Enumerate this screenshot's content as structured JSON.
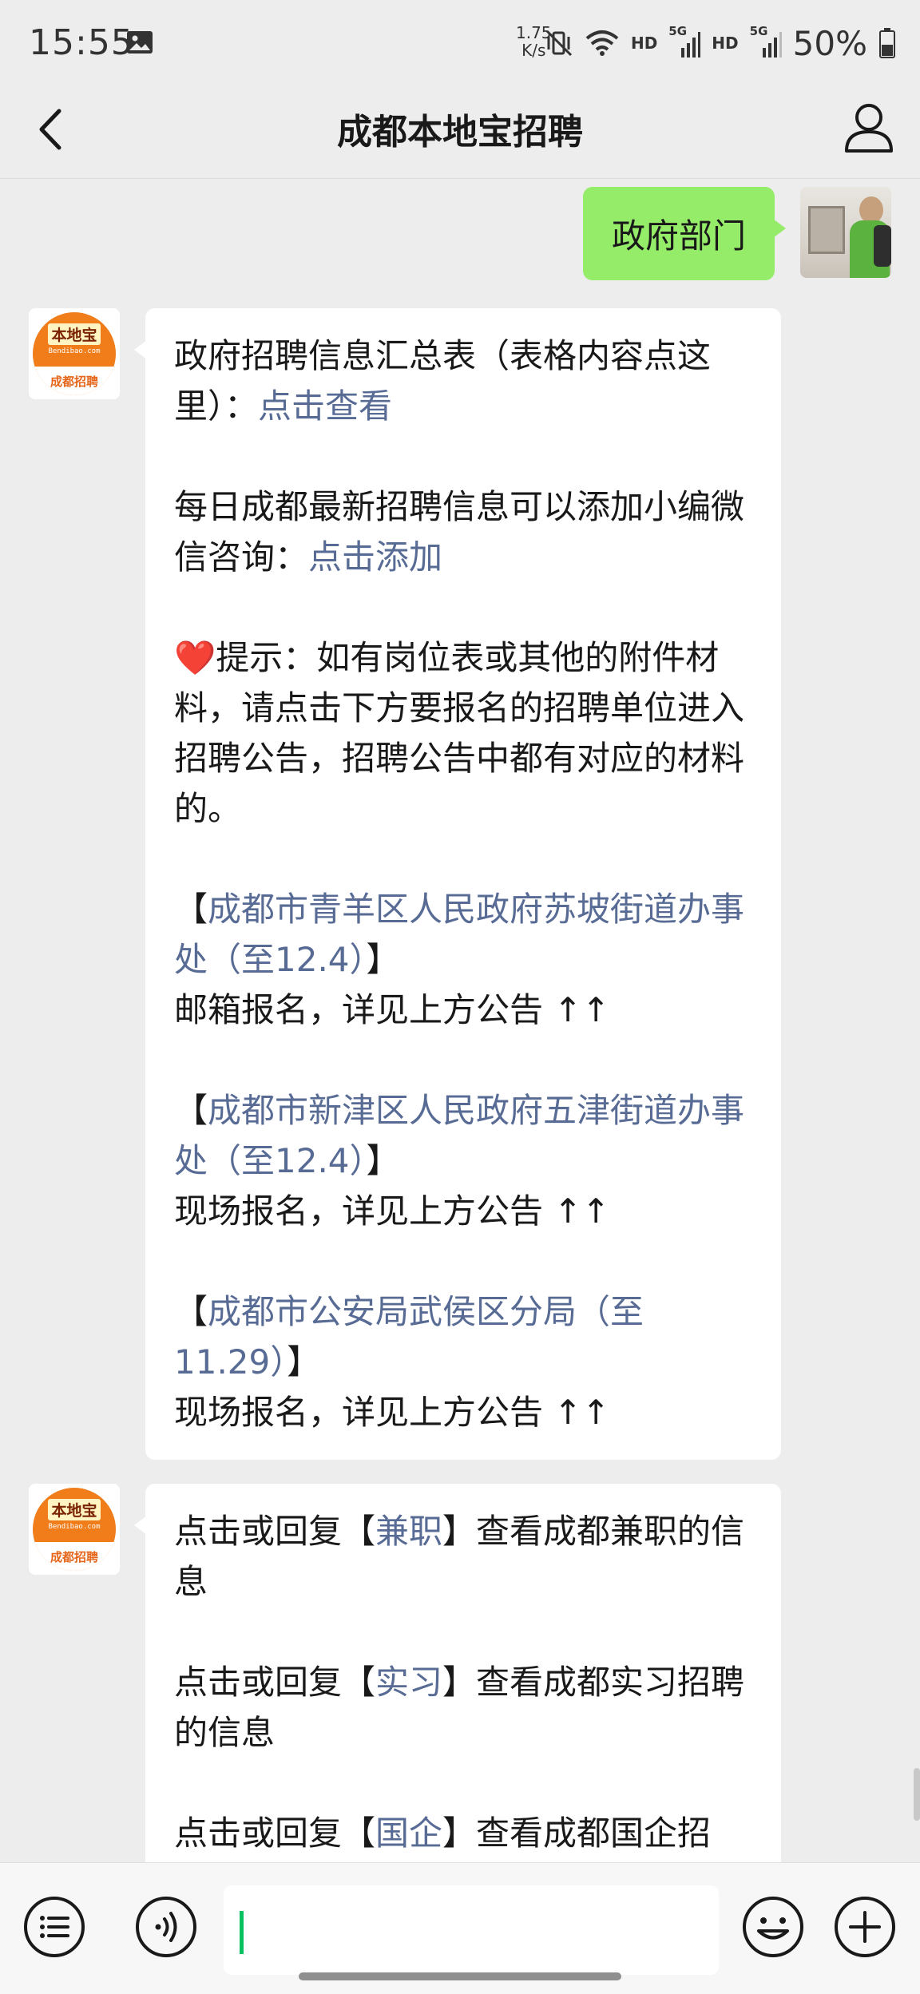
{
  "status_bar": {
    "time": "15:55",
    "net_speed_value": "1.75",
    "net_speed_unit": "K/s",
    "hd1": "HD",
    "hd2": "HD",
    "signal1": "5G",
    "signal2": "5G",
    "battery": "50%"
  },
  "header": {
    "title": "成都本地宝招聘"
  },
  "messages": {
    "outgoing": "政府部门",
    "bot_avatar": {
      "name": "本地宝",
      "url": "Bendibao.com",
      "band": "成都招聘"
    },
    "msg1": {
      "p1_text": "政府招聘信息汇总表（表格内容点这里）：",
      "p1_link": "点击查看",
      "p2_text": "每日成都最新招聘信息可以添加小编微信咨询：",
      "p2_link": "点击添加",
      "tip": "❤️提示：如有岗位表或其他的附件材料，请点击下方要报名的招聘单位进入招聘公告，招聘公告中都有对应的材料的。",
      "entries": [
        {
          "open": "【",
          "link": "成都市青羊区人民政府苏坡街道办事处（至12.4）",
          "close": "】",
          "note": "邮箱报名，详见上方公告 ↑↑"
        },
        {
          "open": "【",
          "link": "成都市新津区人民政府五津街道办事处（至12.4）",
          "close": "】",
          "note": "现场报名，详见上方公告 ↑↑"
        },
        {
          "open": "【",
          "link": "成都市公安局武侯区分局（至11.29）",
          "close": "】",
          "note": "现场报名，详见上方公告 ↑↑"
        }
      ]
    },
    "msg2": {
      "items": [
        {
          "pre": "点击或回复【",
          "link": "兼职",
          "post": "】查看成都兼职的信息"
        },
        {
          "pre": "点击或回复【",
          "link": "实习",
          "post": "】查看成都实习招聘的信息"
        },
        {
          "pre": "点击或回复【",
          "link": "国企",
          "post": "】查看成都国企招"
        }
      ]
    }
  },
  "input_bar": {
    "icons": [
      "menu-list-icon",
      "voice-icon",
      "emoji-icon",
      "plus-icon"
    ],
    "text_value": ""
  },
  "colors": {
    "link": "#576b95",
    "outgoing_bubble": "#95ec69",
    "background": "#ededed",
    "caret": "#07c160"
  }
}
